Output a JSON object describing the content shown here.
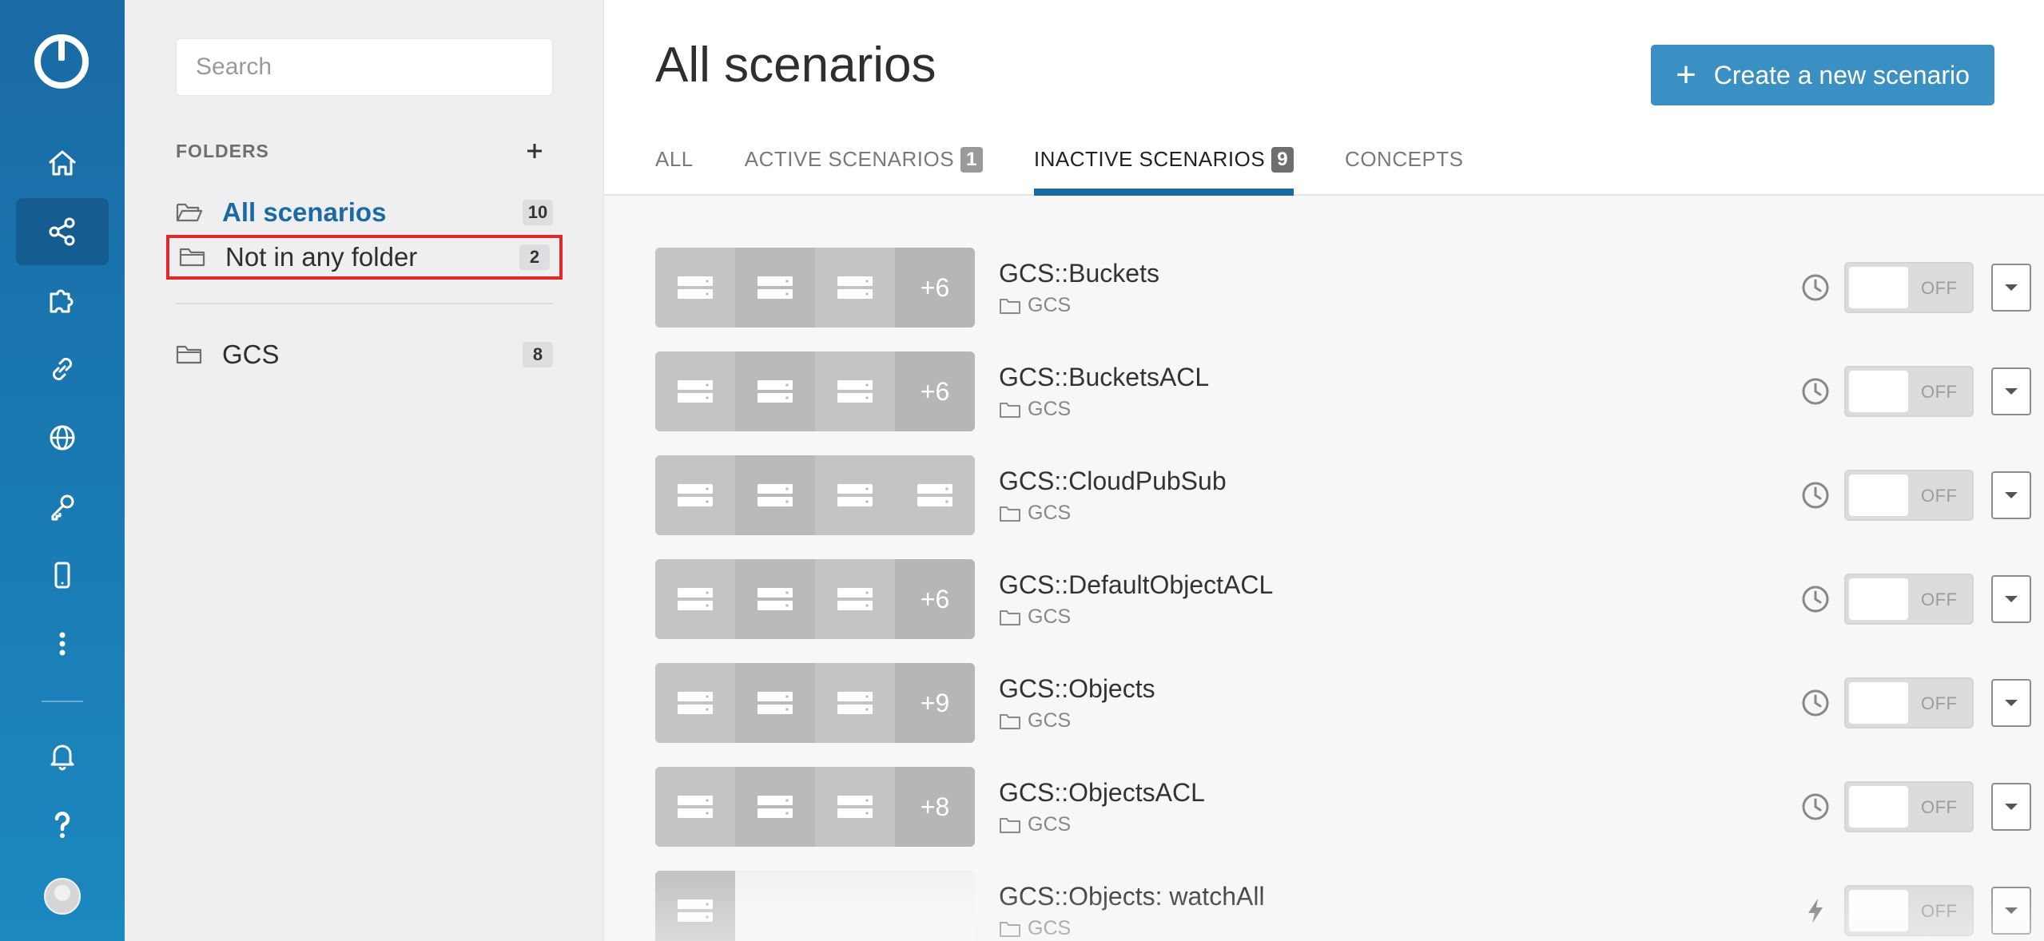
{
  "rail": {
    "logo": "integromat-logo",
    "items": [
      {
        "icon": "home-icon",
        "active": false
      },
      {
        "icon": "share-nodes-icon",
        "active": true
      },
      {
        "icon": "puzzle-icon",
        "active": false
      },
      {
        "icon": "link-icon",
        "active": false
      },
      {
        "icon": "globe-icon",
        "active": false
      },
      {
        "icon": "key-icon",
        "active": false
      },
      {
        "icon": "mobile-icon",
        "active": false
      },
      {
        "icon": "more-vertical-icon",
        "active": false
      }
    ],
    "bottom": [
      {
        "icon": "bell-icon"
      },
      {
        "icon": "help-icon"
      }
    ]
  },
  "folders": {
    "search_placeholder": "Search",
    "heading": "FOLDERS",
    "items": [
      {
        "label": "All scenarios",
        "count": "10"
      },
      {
        "label": "Not in any folder",
        "count": "2"
      },
      {
        "label": "GCS",
        "count": "8"
      }
    ]
  },
  "main": {
    "title": "All scenarios",
    "create_label": "Create a new scenario",
    "tabs": [
      {
        "label": "ALL",
        "badge": ""
      },
      {
        "label": "ACTIVE SCENARIOS",
        "badge": "1"
      },
      {
        "label": "INACTIVE SCENARIOS",
        "badge": "9"
      },
      {
        "label": "CONCEPTS",
        "badge": ""
      }
    ],
    "scenarios": [
      {
        "name": "GCS::Buckets",
        "folder": "GCS",
        "more": "+6",
        "trigger": "clock-icon",
        "state": "OFF"
      },
      {
        "name": "GCS::BucketsACL",
        "folder": "GCS",
        "more": "+6",
        "trigger": "clock-icon",
        "state": "OFF"
      },
      {
        "name": "GCS::CloudPubSub",
        "folder": "GCS",
        "more": "",
        "trigger": "clock-icon",
        "state": "OFF"
      },
      {
        "name": "GCS::DefaultObjectACL",
        "folder": "GCS",
        "more": "+6",
        "trigger": "clock-icon",
        "state": "OFF"
      },
      {
        "name": "GCS::Objects",
        "folder": "GCS",
        "more": "+9",
        "trigger": "clock-icon",
        "state": "OFF"
      },
      {
        "name": "GCS::ObjectsACL",
        "folder": "GCS",
        "more": "+8",
        "trigger": "clock-icon",
        "state": "OFF"
      },
      {
        "name": "GCS::Objects: watchAll",
        "folder": "GCS",
        "more": "",
        "trigger": "bolt-icon",
        "state": "OFF"
      }
    ]
  },
  "colors": {
    "rail_top": "#1a6aa4",
    "rail_bottom": "#1b88c0",
    "accent": "#1a6aa4",
    "create_button": "#3a8fc3",
    "highlight_box": "#e02a2a"
  }
}
